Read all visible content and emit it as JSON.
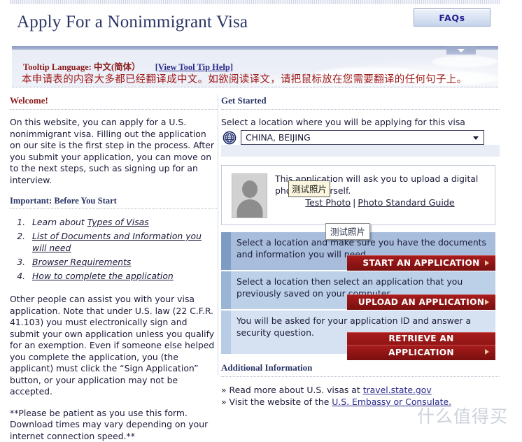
{
  "header": {
    "title": "Apply For a Nonimmigrant Visa",
    "faq_label": "FAQs"
  },
  "tooltip_banner": {
    "label": "Tooltip Language:",
    "language": "中文(简体）",
    "help_link": "[View Tool Tip Help]",
    "notice": "本申请表的内容大多都已经翻译成中文。如欲阅读译文，请把鼠标放在您需要翻译的任何句子上。",
    "collapse_icon": "chevron-down-icon"
  },
  "left": {
    "welcome_heading": "Welcome!",
    "intro": "On this website, you can apply for a U.S. nonimmigrant visa. Filling out the application on our site is the first step in the process. After you submit your application, you can move on to the next steps, such as signing up for an interview.",
    "important_heading": "Important: Before You Start",
    "steps": [
      {
        "prefix": "Learn about ",
        "link": "Types of Visas"
      },
      {
        "prefix": "",
        "link": "List of Documents and Information you will need"
      },
      {
        "prefix": "",
        "link": "Browser Requirements"
      },
      {
        "prefix": "",
        "link": "How to complete the application"
      }
    ],
    "assist_note": "Other people can assist you with your visa application. Note that under U.S. law (22 C.F.R. 41.103) you must electronically sign and submit your own application unless you qualify for an exemption. Even if someone else helped you complete the application, you (the applicant) must click the “Sign Application” button, or your application may not be accepted.",
    "patience_note": "**Please be patient as you use this form. Download times may vary depending on your internet connection speed.**"
  },
  "right": {
    "get_started_heading": "Get Started",
    "location_label": "Select a location where you will be applying for this visa",
    "location_value": "CHINA, BEIJING",
    "globe_icon": "globe-icon",
    "photo": {
      "avatar_icon": "person-silhouette-icon",
      "text": "This application will ask you to upload a digital photo of yourself.",
      "test_photo_link": "Test Photo",
      "separator": "|",
      "standard_guide_link": "Photo Standard Guide"
    },
    "tooltips": [
      {
        "text": "测试照片",
        "style": "cream"
      },
      {
        "text": "测试照片",
        "style": "white"
      }
    ],
    "panels": [
      {
        "text": "Select a location and make sure you have the documents and information you will need.",
        "cta": "START AN APPLICATION",
        "arrow_icon": "arrow-right-icon"
      },
      {
        "text": "Select a location then select an application that you previously saved on your computer.",
        "cta": "UPLOAD AN APPLICATION",
        "arrow_icon": "arrow-right-icon"
      },
      {
        "text": "You will be asked for your application ID and answer a security question.",
        "cta_line1": "RETRIEVE AN",
        "cta_line2": "APPLICATION",
        "arrow_icon": "arrow-right-icon"
      }
    ],
    "additional_heading": "Additional Information",
    "additional_links": [
      {
        "bullet": "»",
        "prefix": "Read more about U.S. visas at ",
        "link": "travel.state.gov",
        "suffix": ""
      },
      {
        "bullet": "»",
        "prefix": "Visit the website of the ",
        "link": "U.S. Embassy or Consulate.",
        "suffix": ""
      }
    ]
  },
  "watermark": "什么值得买",
  "colors": {
    "accent_red": "#8c1b1b",
    "cta_red": "#8d1414",
    "navy": "#2b3566",
    "panel_blue_1": "#a8bddb",
    "panel_blue_2": "#bcd0e8",
    "panel_blue_3": "#d6e2f2"
  }
}
